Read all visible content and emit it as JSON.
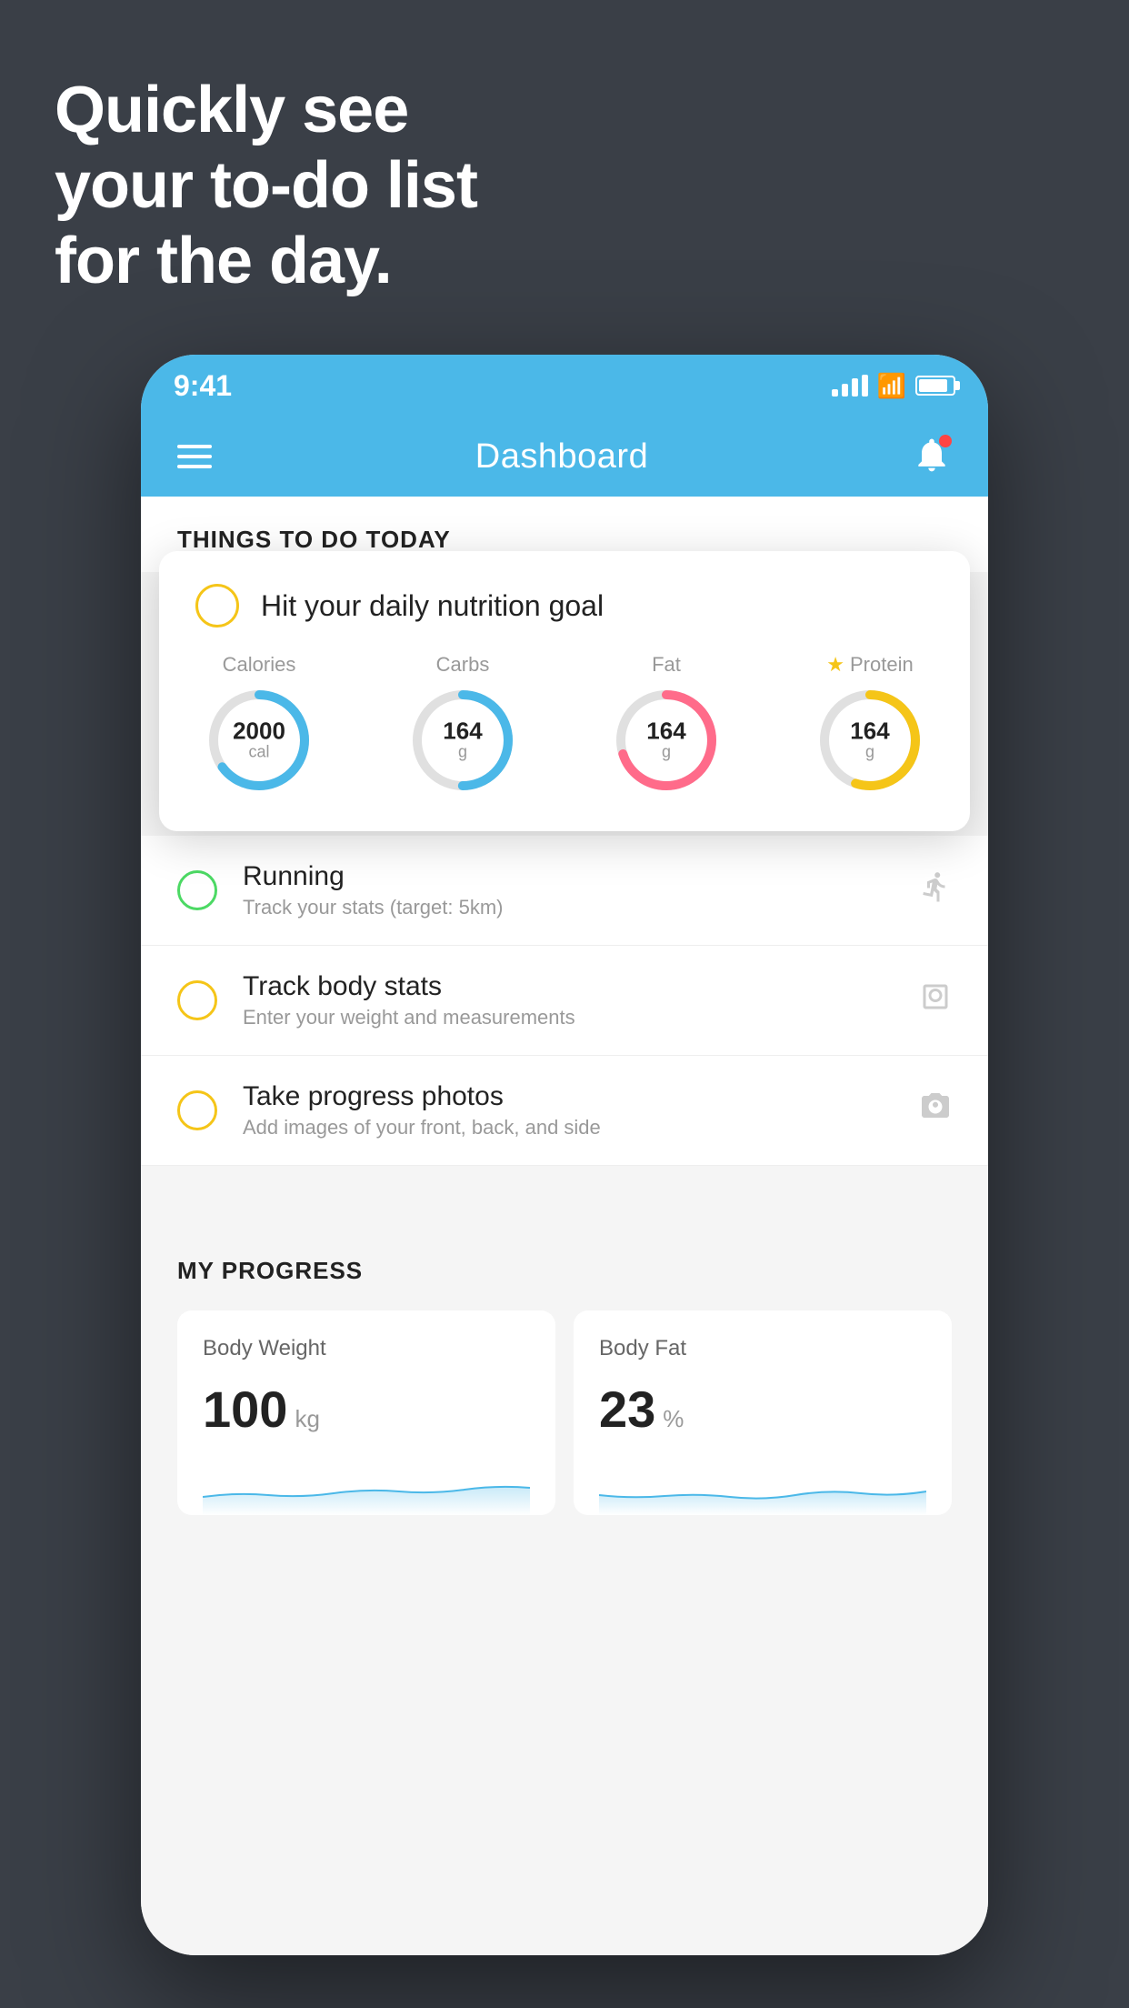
{
  "headline": {
    "line1": "Quickly see",
    "line2": "your to-do list",
    "line3": "for the day."
  },
  "statusBar": {
    "time": "9:41",
    "backgroundColor": "#4bb8e8"
  },
  "navBar": {
    "title": "Dashboard",
    "backgroundColor": "#4bb8e8"
  },
  "thingsToDo": {
    "sectionTitle": "THINGS TO DO TODAY",
    "floatingCard": {
      "title": "Hit your daily nutrition goal",
      "nutrition": [
        {
          "label": "Calories",
          "value": "2000",
          "unit": "cal",
          "color": "#4bb8e8",
          "trackColor": "#e0e0e0",
          "pct": 65
        },
        {
          "label": "Carbs",
          "value": "164",
          "unit": "g",
          "color": "#4bb8e8",
          "trackColor": "#e0e0e0",
          "pct": 50
        },
        {
          "label": "Fat",
          "value": "164",
          "unit": "g",
          "color": "#ff6b8a",
          "trackColor": "#e0e0e0",
          "pct": 70
        },
        {
          "label": "Protein",
          "value": "164",
          "unit": "g",
          "color": "#f5c518",
          "trackColor": "#e0e0e0",
          "pct": 55,
          "star": true
        }
      ]
    },
    "listItems": [
      {
        "title": "Running",
        "subtitle": "Track your stats (target: 5km)",
        "circleColor": "green",
        "icon": "shoe"
      },
      {
        "title": "Track body stats",
        "subtitle": "Enter your weight and measurements",
        "circleColor": "yellow",
        "icon": "scale"
      },
      {
        "title": "Take progress photos",
        "subtitle": "Add images of your front, back, and side",
        "circleColor": "yellow",
        "icon": "photo"
      }
    ]
  },
  "myProgress": {
    "sectionTitle": "MY PROGRESS",
    "cards": [
      {
        "title": "Body Weight",
        "value": "100",
        "unit": "kg"
      },
      {
        "title": "Body Fat",
        "value": "23",
        "unit": "%"
      }
    ]
  }
}
